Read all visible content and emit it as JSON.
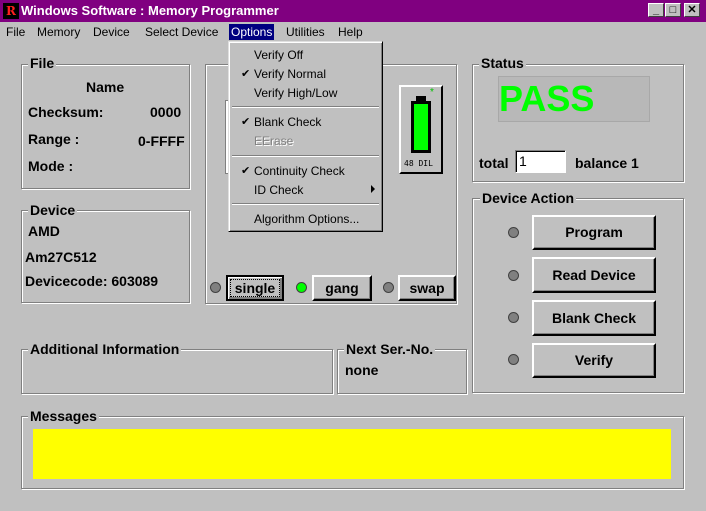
{
  "window": {
    "title": "Windows Software :  Memory Programmer",
    "icon_letter": "R",
    "minimize": "_",
    "maximize": "□",
    "close": "✕"
  },
  "menubar": {
    "items": [
      "File",
      "Memory",
      "Device",
      "Select Device",
      "Options",
      "Utilities",
      "Help"
    ],
    "active": "Options"
  },
  "options_menu": {
    "items": [
      {
        "label": "Verify Off",
        "checked": false,
        "disabled": false
      },
      {
        "label": "Verify Normal",
        "checked": true,
        "disabled": false
      },
      {
        "label": "Verify High/Low",
        "checked": false,
        "disabled": false
      },
      {
        "label": "Blank Check",
        "checked": true,
        "disabled": false
      },
      {
        "label": "EErase",
        "checked": false,
        "disabled": true
      },
      {
        "label": "Continuity Check",
        "checked": true,
        "disabled": false
      },
      {
        "label": "ID Check",
        "checked": false,
        "disabled": false,
        "submenu": true
      },
      {
        "label": "Algorithm Options...",
        "checked": false,
        "disabled": false
      }
    ],
    "checkmark": "✔"
  },
  "file_group": {
    "title": "File",
    "name_label": "Name",
    "checksum_label": "Checksum:",
    "checksum_value": "0000",
    "range_label": "Range :",
    "range_value": "0-FFFF",
    "mode_label": "Mode :"
  },
  "device_group": {
    "title": "Device",
    "manufacturer": "AMD",
    "part": "Am27C512",
    "devicecode": "Devicecode: 603089"
  },
  "socket": {
    "label": "48 DIL",
    "star": "*"
  },
  "modes": {
    "single": "single",
    "gang": "gang",
    "swap": "swap",
    "active": "gang"
  },
  "status_group": {
    "title": "Status",
    "result": "PASS",
    "result_color": "#00ff00",
    "total_label": "total",
    "total_value": "1",
    "balance": "balance 1"
  },
  "device_action": {
    "title": "Device Action",
    "buttons": [
      "Program",
      "Read Device",
      "Blank Check",
      "Verify"
    ]
  },
  "additional_info": {
    "title": "Additional Information"
  },
  "next_serial": {
    "title": "Next Ser.-No.",
    "value": "none"
  },
  "messages": {
    "title": "Messages",
    "panel_color": "#ffff00"
  }
}
